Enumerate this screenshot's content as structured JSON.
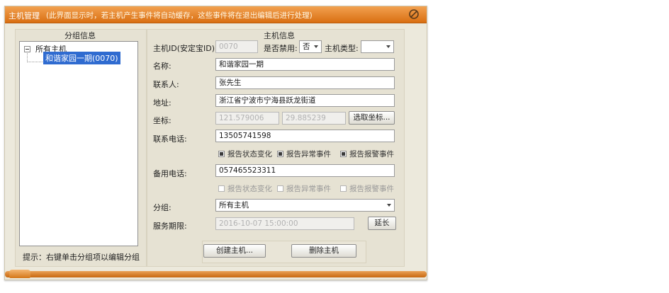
{
  "window": {
    "title": "主机管理",
    "note": "(此界面显示时，若主机产生事件将自动缓存，这些事件将在退出编辑后进行处理)"
  },
  "group_panel": {
    "title": "分组信息",
    "tree": {
      "root_label": "所有主机",
      "child_label": "和谐家园一期(0070)"
    },
    "hint": "提示：右键单击分组项以编辑分组"
  },
  "host_panel": {
    "title": "主机信息",
    "host_id": {
      "label": "主机ID(安定宝ID):",
      "value": "0070"
    },
    "disabled": {
      "label": "是否禁用:",
      "value": "否"
    },
    "host_type": {
      "label": "主机类型:",
      "value": ""
    },
    "name": {
      "label": "名称:",
      "value": "和谐家园一期"
    },
    "contact": {
      "label": "联系人:",
      "value": "张先生"
    },
    "address": {
      "label": "地址:",
      "value": "浙江省宁波市宁海县跃龙街道"
    },
    "coords": {
      "label": "坐标:",
      "lng": "121.579006",
      "lat": "29.885239",
      "pick_button": "选取坐标..."
    },
    "phone": {
      "label": "联系电话:",
      "value": "13505741598"
    },
    "phone_reports": [
      {
        "label": "报告状态变化",
        "checked": true
      },
      {
        "label": "报告异常事件",
        "checked": true
      },
      {
        "label": "报告报警事件",
        "checked": true
      }
    ],
    "backup_phone": {
      "label": "备用电话:",
      "value": "057465523311"
    },
    "backup_reports": [
      {
        "label": "报告状态变化",
        "checked": false
      },
      {
        "label": "报告异常事件",
        "checked": false
      },
      {
        "label": "报告报警事件",
        "checked": false
      }
    ],
    "group": {
      "label": "分组:",
      "value": "所有主机"
    },
    "service_period": {
      "label": "服务期限:",
      "value": "2016-10-07 15:00:00",
      "extend_button": "延长"
    },
    "create_button": "创建主机...",
    "delete_button": "删除主机"
  }
}
